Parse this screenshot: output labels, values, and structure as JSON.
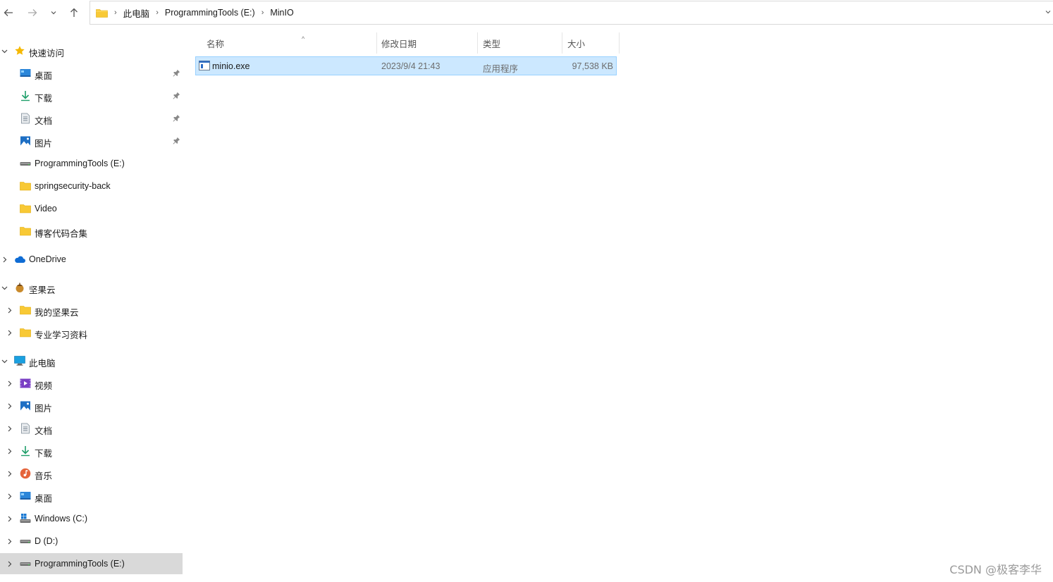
{
  "breadcrumb": [
    "此电脑",
    "ProgrammingTools (E:)",
    "MinIO"
  ],
  "nav": {
    "quick_access": {
      "label": "快速访问",
      "items": [
        {
          "label": "桌面",
          "icon": "desktop-icon",
          "pinned": true
        },
        {
          "label": "下载",
          "icon": "download-icon",
          "pinned": true
        },
        {
          "label": "文档",
          "icon": "document-icon",
          "pinned": true
        },
        {
          "label": "图片",
          "icon": "pictures-icon",
          "pinned": true
        },
        {
          "label": "ProgrammingTools (E:)",
          "icon": "drive-icon",
          "pinned": false
        },
        {
          "label": "springsecurity-back",
          "icon": "folder-icon",
          "pinned": false
        },
        {
          "label": "Video",
          "icon": "folder-icon",
          "pinned": false
        },
        {
          "label": "博客代码合集",
          "icon": "folder-icon",
          "pinned": false
        }
      ]
    },
    "onedrive": {
      "label": "OneDrive"
    },
    "nutstore": {
      "label": "坚果云",
      "items": [
        {
          "label": "我的坚果云",
          "icon": "folder-icon"
        },
        {
          "label": "专业学习资料",
          "icon": "folder-icon"
        }
      ]
    },
    "this_pc": {
      "label": "此电脑",
      "items": [
        {
          "label": "视频",
          "icon": "videos-icon"
        },
        {
          "label": "图片",
          "icon": "pictures-icon"
        },
        {
          "label": "文档",
          "icon": "document-icon"
        },
        {
          "label": "下载",
          "icon": "download-icon"
        },
        {
          "label": "音乐",
          "icon": "music-icon"
        },
        {
          "label": "桌面",
          "icon": "desktop-icon"
        },
        {
          "label": "Windows (C:)",
          "icon": "windows-drive-icon"
        },
        {
          "label": "D (D:)",
          "icon": "drive-icon"
        },
        {
          "label": "ProgrammingTools (E:)",
          "icon": "drive-icon"
        }
      ]
    }
  },
  "columns": {
    "name": "名称",
    "modified": "修改日期",
    "type": "类型",
    "size": "大小"
  },
  "files": [
    {
      "name": "minio.exe",
      "modified": "2023/9/4 21:43",
      "type": "应用程序",
      "size": "97,538 KB",
      "selected": true
    }
  ],
  "watermark": "CSDN @极客李华",
  "colors": {
    "selection": "#cce8ff",
    "selection_border": "#99d1ff",
    "nav_selected": "#d9d9d9",
    "folder": "#f8c935",
    "star": "#f5b800"
  }
}
